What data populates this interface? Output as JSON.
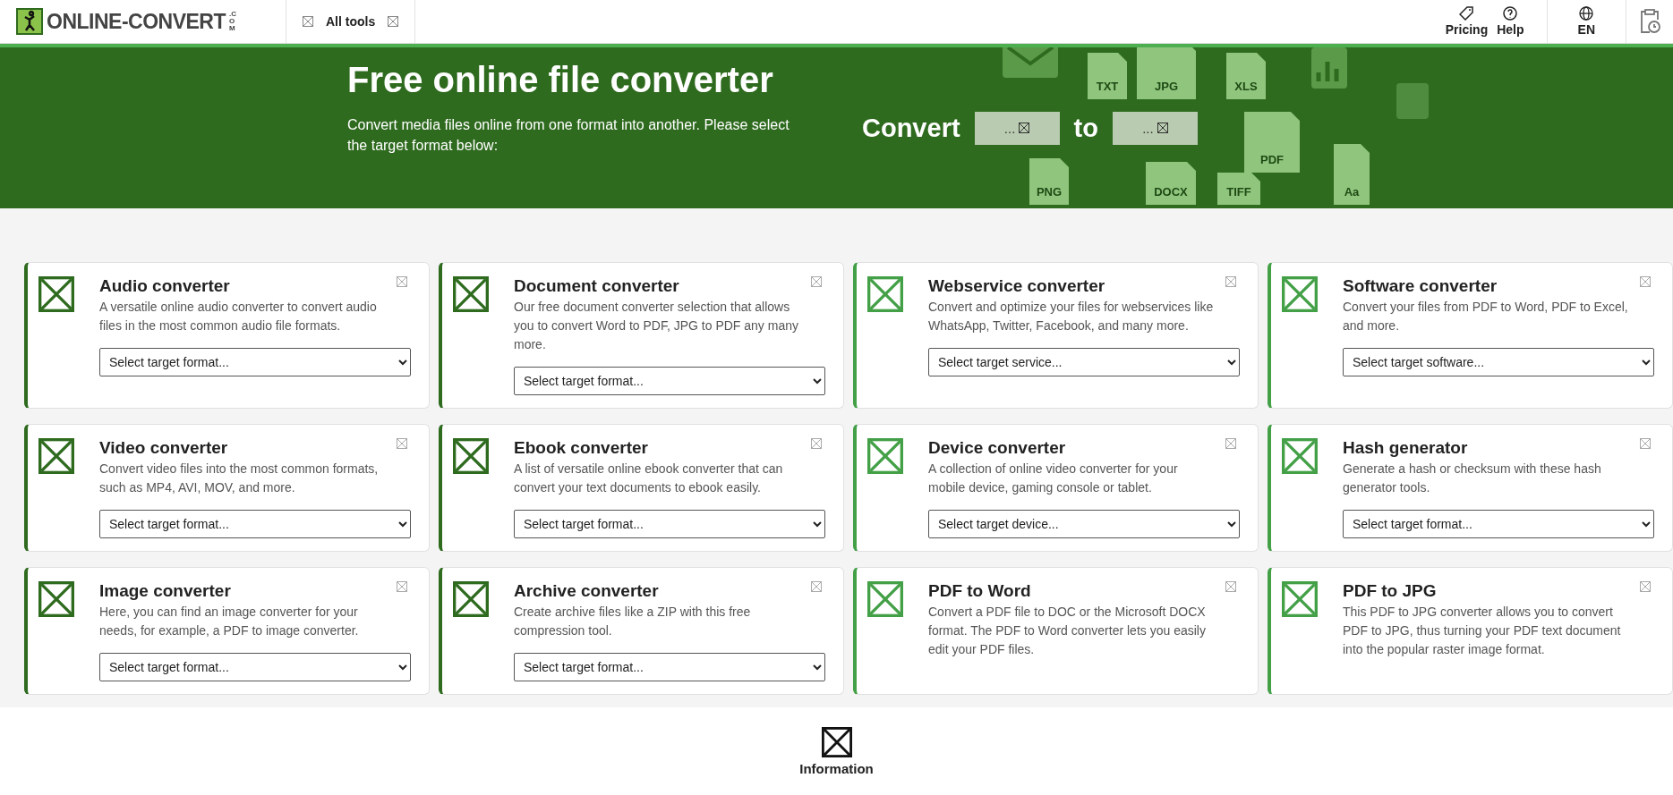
{
  "header": {
    "logo": {
      "name": "ONLINE-CONVERT",
      "suffix": ".COM"
    },
    "nav": [
      {
        "label": "All tools"
      }
    ],
    "actions": [
      {
        "label": "Pricing",
        "kind": "tag"
      },
      {
        "label": "Help",
        "kind": "help"
      }
    ],
    "language": "EN"
  },
  "hero": {
    "title": "Free online file converter",
    "subtitle": "Convert media files online from one format into another. Please select the target format below:",
    "convert_label": "Convert",
    "from_value": "...",
    "to_label": "to",
    "to_value": "...",
    "file_labels": [
      "TXT",
      "JPG",
      "XLS",
      "PDF",
      "PNG",
      "DOCX",
      "TIFF",
      "Aa"
    ]
  },
  "cards": [
    {
      "title": "Audio converter",
      "description": "A versatile online audio converter to convert audio files in the most common audio file formats.",
      "select": "Select target format...",
      "color": "#2e6b1f"
    },
    {
      "title": "Document converter",
      "description": "Our free document converter selection that allows you to convert Word to PDF, JPG to PDF any many more.",
      "select": "Select target format...",
      "color": "#2e6b1f"
    },
    {
      "title": "Webservice converter",
      "description": "Convert and optimize your files for webservices like WhatsApp, Twitter, Facebook, and many more.",
      "select": "Select target service...",
      "color": "#43a047"
    },
    {
      "title": "Software converter",
      "description": "Convert your files from PDF to Word, PDF to Excel, and more.",
      "select": "Select target software...",
      "color": "#43a047"
    },
    {
      "title": "Video converter",
      "description": "Convert video files into the most common formats, such as MP4, AVI, MOV, and more.",
      "select": "Select target format...",
      "color": "#2e6b1f"
    },
    {
      "title": "Ebook converter",
      "description": "A list of versatile online ebook converter that can convert your text documents to ebook easily.",
      "select": "Select target format...",
      "color": "#2e6b1f"
    },
    {
      "title": "Device converter",
      "description": "A collection of online video converter for your mobile device, gaming console or tablet.",
      "select": "Select target device...",
      "color": "#43a047"
    },
    {
      "title": "Hash generator",
      "description": "Generate a hash or checksum with these hash generator tools.",
      "select": "Select target format...",
      "color": "#43a047"
    },
    {
      "title": "Image converter",
      "description": "Here, you can find an image converter for your needs, for example, a PDF to image converter.",
      "select": "Select target format...",
      "color": "#2e6b1f"
    },
    {
      "title": "Archive converter",
      "description": "Create archive files like a ZIP with this free compression tool.",
      "select": "Select target format...",
      "color": "#2e6b1f"
    },
    {
      "title": "PDF to Word",
      "description": "Convert a PDF file to DOC or the Microsoft DOCX format. The PDF to Word converter lets you easily edit your PDF files.",
      "color": "#43a047"
    },
    {
      "title": "PDF to JPG",
      "description": "This PDF to JPG converter allows you to convert PDF to JPG, thus turning your PDF text document into the popular raster image format.",
      "color": "#43a047"
    }
  ],
  "info": {
    "label": "Information"
  }
}
